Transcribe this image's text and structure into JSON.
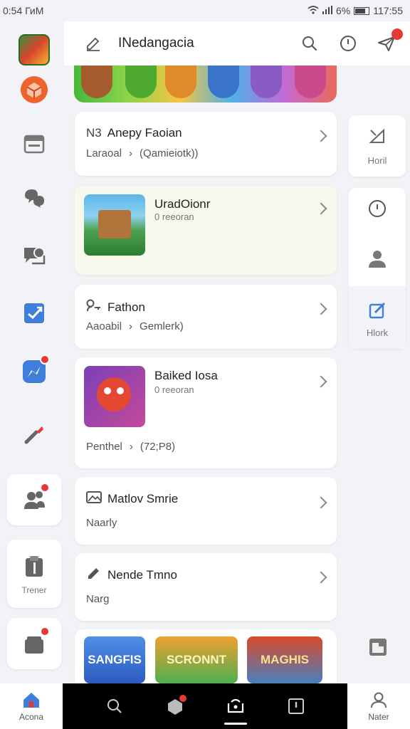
{
  "status": {
    "time": "0:54 ГиМ",
    "battery": "6%",
    "clock": "117:55"
  },
  "rail": {
    "items": [
      {
        "name": "rail-game-avatar",
        "icon": "game-avatar-icon"
      },
      {
        "name": "rail-orange-cube",
        "icon": "orange-cube-icon"
      },
      {
        "name": "rail-calendar",
        "icon": "calendar-icon"
      },
      {
        "name": "rail-chat",
        "icon": "chat-icon"
      },
      {
        "name": "rail-message",
        "icon": "message-icon"
      },
      {
        "name": "rail-check",
        "icon": "check-icon"
      },
      {
        "name": "rail-messenger",
        "icon": "messenger-icon"
      },
      {
        "name": "rail-tool",
        "icon": "tool-icon"
      },
      {
        "name": "rail-friends",
        "icon": "friends-icon"
      },
      {
        "name": "rail-trener",
        "icon": "clipboard-icon",
        "label": "Trener"
      },
      {
        "name": "rail-gift",
        "icon": "gift-icon"
      }
    ]
  },
  "header": {
    "title": "INedangacia",
    "notification_count": ""
  },
  "cards": [
    {
      "prefix": "N3",
      "title": "Anepy Faoian",
      "sub_a": "Laraoal",
      "sub_b": "(Qamieiotk))"
    },
    {
      "title": "UradOionr",
      "sub": "0 reeoran"
    },
    {
      "title": "Fathon",
      "sub_a": "Aaoabil",
      "sub_b": "Gemlerk)"
    },
    {
      "title": "Baiked Iosa",
      "sub": "0 reeoran",
      "sub_a": "Penthel",
      "sub_b": "(72;P8)"
    },
    {
      "title": "Matlov Smrie",
      "sub": "Naarly"
    },
    {
      "title": "Nende Tmno",
      "sub": "Narg"
    }
  ],
  "right_rail": {
    "top_label": "Horil",
    "bottom_label": "Hlork"
  },
  "bottom_games": [
    "SANGFIS",
    "SCRONNT",
    "MAGHIS"
  ],
  "bottom_nav": {
    "left_label": "Acona",
    "right_label": "Nater"
  },
  "colors": {
    "accent_blue": "#3f7fdc",
    "badge_red": "#e53935"
  }
}
